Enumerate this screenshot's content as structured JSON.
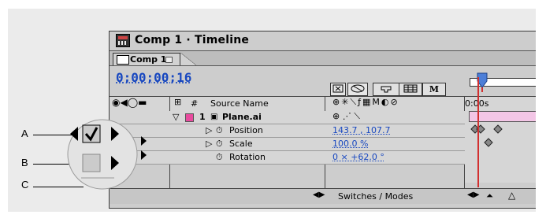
{
  "window": {
    "title": "Comp 1 · Timeline",
    "tab_label": "Comp 1"
  },
  "header": {
    "current_time": "0;00;00;16",
    "button_m": "M"
  },
  "columns": {
    "hash": "#",
    "source_name": "Source Name",
    "time_label": "0:00s"
  },
  "layer": {
    "index": "1",
    "name": "Plane.ai"
  },
  "properties": [
    {
      "name": "Position",
      "value": "143.7 , 107.7"
    },
    {
      "name": "Scale",
      "value": "100.0 %"
    },
    {
      "name": "Rotation",
      "value": "0 × +62.0 °"
    }
  ],
  "footer": {
    "switches_label": "Switches / Modes"
  },
  "callouts": {
    "a": "A",
    "b": "B",
    "c": "C"
  },
  "colors": {
    "accent_blue": "#1747c0",
    "layer_pink": "#f3c6e6",
    "time_marker": "#d23030",
    "label_color": "#e84a9e"
  }
}
